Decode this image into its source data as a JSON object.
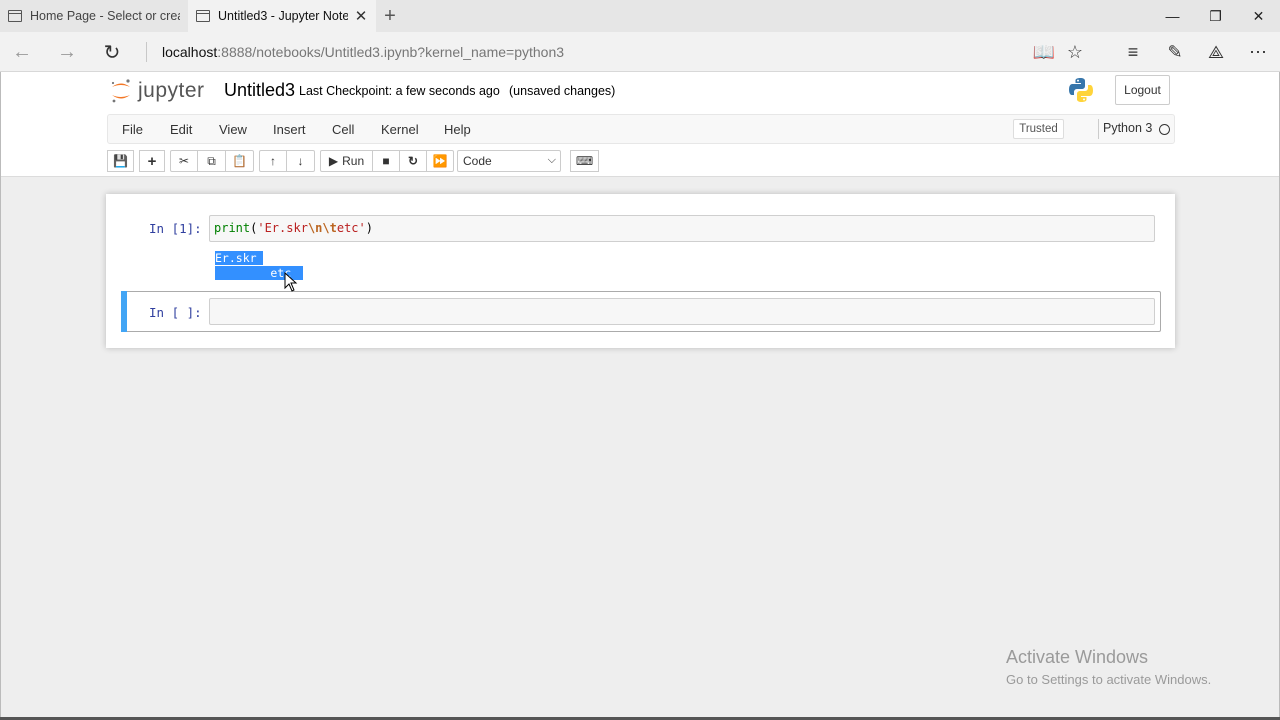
{
  "browser": {
    "tabs": [
      {
        "title": "Home Page - Select or create",
        "active": false
      },
      {
        "title": "Untitled3 - Jupyter Note",
        "active": true
      }
    ],
    "url_host": "localhost",
    "url_rest": ":8888/notebooks/Untitled3.ipynb?kernel_name=python3"
  },
  "header": {
    "logo_text": "jupyter",
    "notebook_name": "Untitled3",
    "checkpoint": "Last Checkpoint: a few seconds ago",
    "unsaved": "(unsaved changes)",
    "logout_label": "Logout"
  },
  "menu": {
    "items": [
      "File",
      "Edit",
      "View",
      "Insert",
      "Cell",
      "Kernel",
      "Help"
    ],
    "trusted": "Trusted",
    "kernel_name": "Python 3"
  },
  "toolbar": {
    "run_label": "Run",
    "cell_type": "Code"
  },
  "cells": [
    {
      "prompt": "In [1]:",
      "code_fn": "print",
      "code_open": "(",
      "code_str1": "'Er.skr",
      "code_esc1": "\\n",
      "code_esc2": "\\t",
      "code_str2": "etc'",
      "code_close": ")",
      "output_lines": [
        "Er.skr",
        "        etc"
      ]
    },
    {
      "prompt": "In [ ]:",
      "code": ""
    }
  ],
  "watermark": {
    "line1": "Activate Windows",
    "line2": "Go to Settings to activate Windows."
  }
}
